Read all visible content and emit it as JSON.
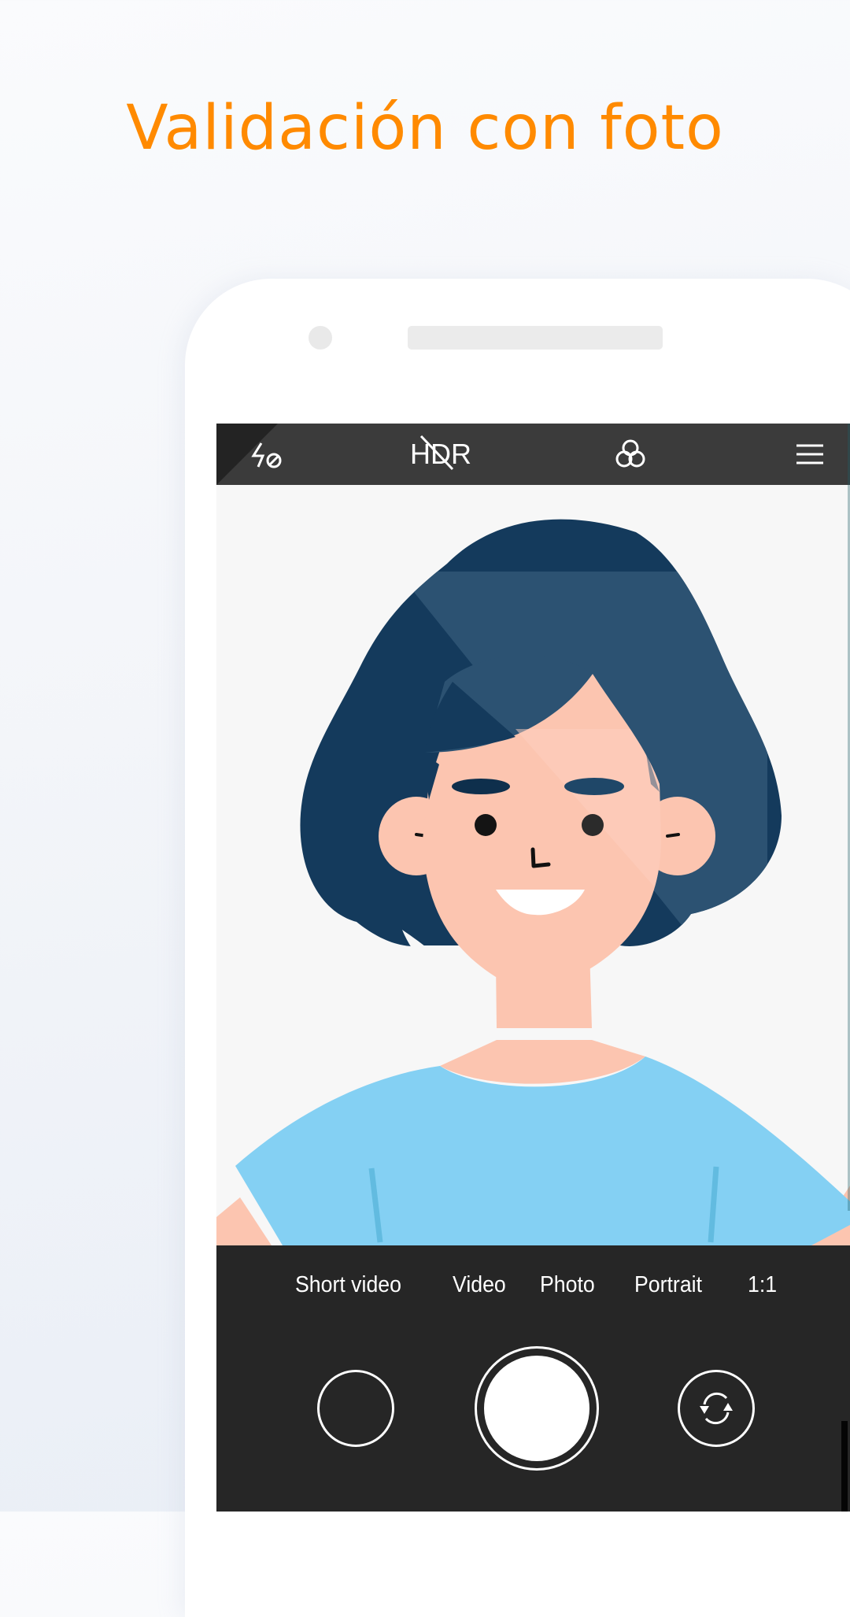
{
  "headline": "Validación con foto",
  "camera": {
    "top_bar": {
      "flash": {
        "icon": "flash-off-icon",
        "state": "off"
      },
      "hdr": {
        "label": "HDR",
        "icon": "hdr-off-icon",
        "state": "off"
      },
      "filters": {
        "icon": "filters-icon"
      },
      "menu": {
        "icon": "menu-icon"
      }
    },
    "modes": [
      {
        "label": "Short video",
        "selected": false
      },
      {
        "label": "Video",
        "selected": false
      },
      {
        "label": "Photo",
        "selected": true
      },
      {
        "label": "Portrait",
        "selected": false
      },
      {
        "label": "1:1",
        "selected": false
      }
    ],
    "controls": {
      "gallery": {
        "icon": "gallery-thumbnail-icon"
      },
      "shutter": {
        "icon": "shutter-icon"
      },
      "flip": {
        "icon": "switch-camera-icon"
      }
    }
  },
  "colors": {
    "headline": "#ff8a00",
    "bar_dark": "#262626",
    "top_bar": "#3b3b3b",
    "hair": "#143a5c",
    "hair_light": "#2c5272",
    "skin": "#fcc5b0",
    "shirt": "#84d0f3",
    "shirt_seam": "#62bbe0"
  }
}
